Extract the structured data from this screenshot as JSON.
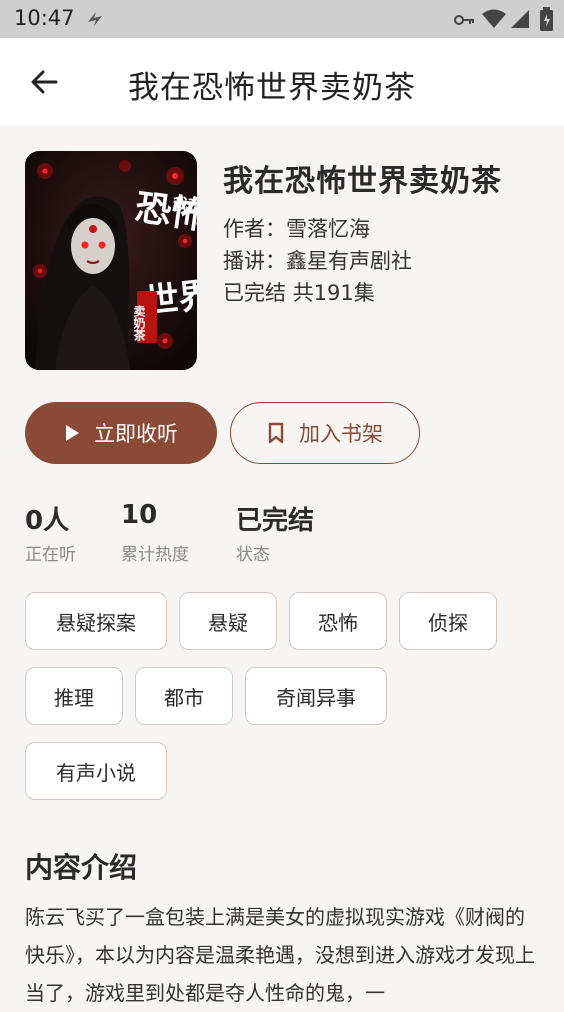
{
  "status_bar": {
    "time": "10:47"
  },
  "header": {
    "title": "我在恐怖世界卖奶茶"
  },
  "book": {
    "title": "我在恐怖世界卖奶茶",
    "author": "作者：雪落忆海",
    "narrator": "播讲：鑫星有声剧社",
    "status_line": "已完结 共191集",
    "cover_text_1": "我在",
    "cover_text_2": "恐怖",
    "cover_text_3": "世界",
    "cover_text_4": "卖奶茶"
  },
  "actions": {
    "listen_label": "立即收听",
    "shelf_label": "加入书架"
  },
  "stats": [
    {
      "value": "0人",
      "label": "正在听"
    },
    {
      "value": "10",
      "label": "累计热度"
    },
    {
      "value": "已完结",
      "label": "状态"
    }
  ],
  "tags": [
    "悬疑探案",
    "悬疑",
    "恐怖",
    "侦探",
    "推理",
    "都市",
    "奇闻异事",
    "有声小说"
  ],
  "intro": {
    "heading": "内容介绍",
    "text": "陈云飞买了一盒包装上满是美女的虚拟现实游戏《财阀的快乐》，本以为内容是温柔艳遇，没想到进入游戏才发现上当了，游戏里到处都是夺人性命的鬼，一"
  },
  "colors": {
    "accent": "#8a4a35",
    "tag_border": "#d9c6bf",
    "background": "#f7f5f2"
  },
  "icons": [
    "wifi-icon",
    "signal-icon",
    "battery-icon",
    "key-icon",
    "back-arrow-icon",
    "play-icon",
    "bookmark-icon"
  ]
}
